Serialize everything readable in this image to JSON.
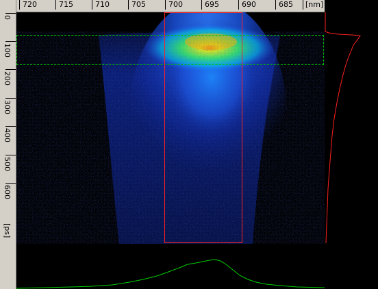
{
  "x_axis": {
    "ticks": [
      "720",
      "715",
      "710",
      "705",
      "700",
      "695",
      "690",
      "685"
    ],
    "unit": "[nm]"
  },
  "y_axis": {
    "ticks": [
      "0",
      "100",
      "200",
      "300",
      "400",
      "500",
      "600"
    ],
    "unit": "[ps]"
  },
  "colors": {
    "ruler_background": "#d4d0c8",
    "plot_background": "#000000",
    "time_roi": "#ff2020",
    "wavelength_roi": "#00c000",
    "time_profile": "#ff2020",
    "spectrum_profile": "#00d000"
  }
}
